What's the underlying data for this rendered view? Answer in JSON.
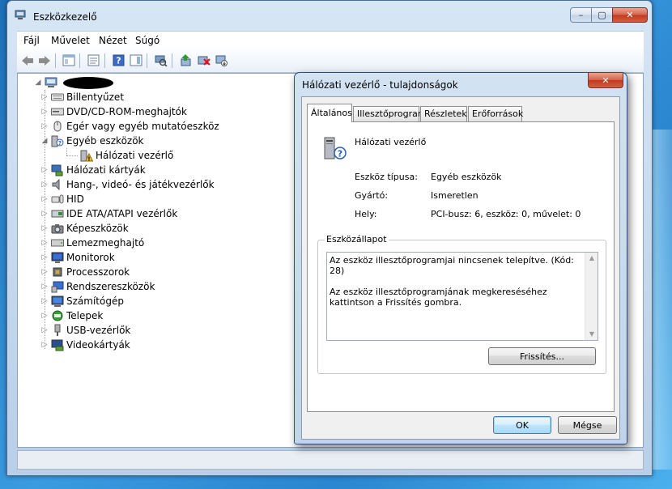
{
  "window": {
    "title": "Eszközkezelő",
    "controls": {
      "minimize": "–",
      "maximize": "▢",
      "close": "✕"
    }
  },
  "menu": {
    "items": [
      "Fájl",
      "Művelet",
      "Nézet",
      "Súgó"
    ]
  },
  "toolbar": {
    "icons": [
      "back-arrow-icon",
      "forward-arrow-icon",
      "console-tree-icon",
      "properties-icon",
      "help-icon",
      "action-pane-icon",
      "scan-hardware-icon",
      "update-driver-icon",
      "uninstall-device-icon",
      "disable-device-icon"
    ]
  },
  "tree": {
    "items": [
      {
        "label": "Billentyűzet",
        "icon": "keyboard-icon",
        "level": 1,
        "expander": "▷"
      },
      {
        "label": "DVD/CD-ROM-meghajtók",
        "icon": "optical-drive-icon",
        "level": 1,
        "expander": "▷"
      },
      {
        "label": "Egér vagy egyéb mutatóeszköz",
        "icon": "mouse-icon",
        "level": 1,
        "expander": "▷"
      },
      {
        "label": "Egyéb eszközök",
        "icon": "unknown-device-icon",
        "level": 1,
        "expander": "◢"
      },
      {
        "label": "Hálózati vezérlő",
        "icon": "warning-device-icon",
        "level": 2,
        "expander": ""
      },
      {
        "label": "Hálózati kártyák",
        "icon": "network-adapter-icon",
        "level": 1,
        "expander": "▷"
      },
      {
        "label": "Hang-, videó- és játékvezérlők",
        "icon": "speaker-icon",
        "level": 1,
        "expander": "▷"
      },
      {
        "label": "HID",
        "icon": "hid-icon",
        "level": 1,
        "expander": "▷"
      },
      {
        "label": "IDE ATA/ATAPI vezérlők",
        "icon": "ide-controller-icon",
        "level": 1,
        "expander": "▷"
      },
      {
        "label": "Képeszközök",
        "icon": "camera-icon",
        "level": 1,
        "expander": "▷"
      },
      {
        "label": "Lemezmeghajtó",
        "icon": "disk-drive-icon",
        "level": 1,
        "expander": "▷"
      },
      {
        "label": "Monitorok",
        "icon": "monitor-icon",
        "level": 1,
        "expander": "▷"
      },
      {
        "label": "Processzorok",
        "icon": "processor-icon",
        "level": 1,
        "expander": "▷"
      },
      {
        "label": "Rendszereszközök",
        "icon": "system-device-icon",
        "level": 1,
        "expander": "▷"
      },
      {
        "label": "Számítógép",
        "icon": "computer-icon",
        "level": 1,
        "expander": "▷"
      },
      {
        "label": "Telepek",
        "icon": "battery-icon",
        "level": 1,
        "expander": "▷"
      },
      {
        "label": "USB-vezérlők",
        "icon": "usb-icon",
        "level": 1,
        "expander": "▷"
      },
      {
        "label": "Videokártyák",
        "icon": "display-adapter-icon",
        "level": 1,
        "expander": "▷"
      }
    ]
  },
  "dialog": {
    "title": "Hálózati vezérlő - tulajdonságok",
    "tabs": [
      "Általános",
      "Illesztőprogram",
      "Részletek",
      "Erőforrások"
    ],
    "active_tab": "Általános",
    "device_name": "Hálózati vezérlő",
    "properties": [
      {
        "label": "Eszköz típusa:",
        "value": "Egyéb eszközök"
      },
      {
        "label": "Gyártó:",
        "value": "Ismeretlen"
      },
      {
        "label": "Hely:",
        "value": "PCI-busz: 6, eszköz: 0, művelet: 0"
      }
    ],
    "status_group_title": "Eszközállapot",
    "status_text": "Az eszköz illesztőprogramjai nincsenek telepítve. (Kód: 28)\n\nAz eszköz illesztőprogramjának megkereséséhez kattintson a Frissítés gombra.",
    "update_button": "Frissítés...",
    "ok_button": "OK",
    "cancel_button": "Mégse"
  }
}
